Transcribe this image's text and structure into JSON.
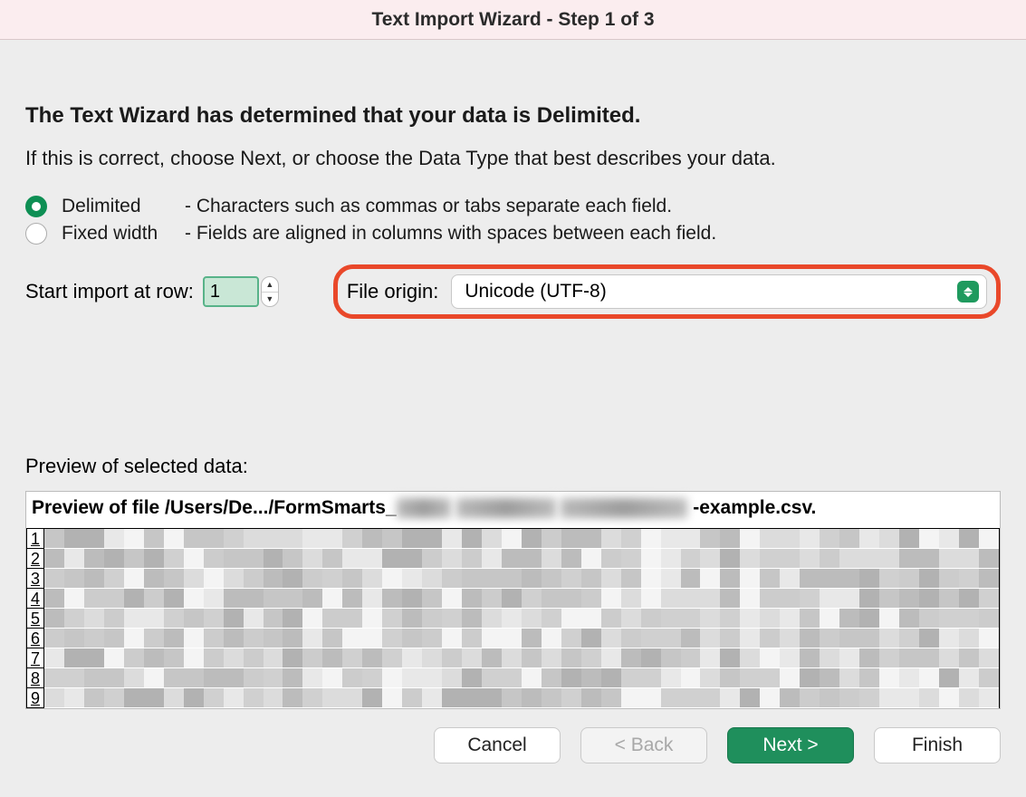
{
  "title": "Text Import Wizard - Step 1 of 3",
  "heading": "The Text Wizard has determined that your data is Delimited.",
  "sub": "If this is correct, choose Next, or choose the Data Type that best describes your data.",
  "options": {
    "delimited": {
      "label": "Delimited",
      "desc": "- Characters such as commas or tabs separate each field."
    },
    "fixed": {
      "label": "Fixed width",
      "desc": "- Fields are aligned in columns with spaces between each field."
    }
  },
  "start_row": {
    "label": "Start import at row:",
    "value": "1"
  },
  "file_origin": {
    "label": "File origin:",
    "value": "Unicode (UTF-8)"
  },
  "preview": {
    "label": "Preview of selected data:",
    "header_prefix": "Preview of file /Users/De.../FormSmarts_",
    "header_suffix": "-example.csv.",
    "row_numbers": [
      "1",
      "2",
      "3",
      "4",
      "5",
      "6",
      "7",
      "8",
      "9"
    ]
  },
  "buttons": {
    "cancel": "Cancel",
    "back": "< Back",
    "next": "Next >",
    "finish": "Finish"
  }
}
